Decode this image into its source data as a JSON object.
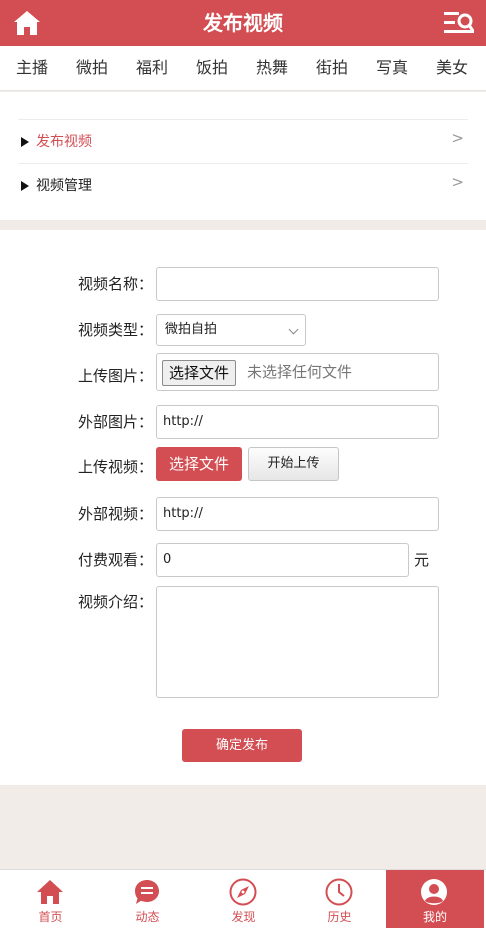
{
  "header": {
    "title": "发布视频",
    "left_icon": "home-icon",
    "right_icon": "search-menu-icon"
  },
  "categories": [
    "主播",
    "微拍",
    "福利",
    "饭拍",
    "热舞",
    "街拍",
    "写真",
    "美女"
  ],
  "sidebar": {
    "items": [
      {
        "label": "发布视频",
        "active": true,
        "chevron": ">"
      },
      {
        "label": "视频管理",
        "active": false,
        "chevron": ">"
      }
    ]
  },
  "form": {
    "name_label": "视频名称：",
    "name_value": "",
    "type_label": "视频类型：",
    "type_value": "微拍自拍",
    "upload_image_label": "上传图片：",
    "choose_file_button": "选择文件",
    "no_file_text": "未选择任何文件",
    "external_image_label": "外部图片：",
    "external_image_value": "http://",
    "upload_video_label": "上传视频：",
    "upload_video_choose": "选择文件",
    "start_upload_button": "开始上传",
    "external_video_label": "外部视频：",
    "external_video_value": "http://",
    "paid_label": "付费观看：",
    "paid_value": "0",
    "paid_unit": "元",
    "intro_label": "视频介绍：",
    "submit_button": "确定发布"
  },
  "tabbar": {
    "items": [
      {
        "label": "首页",
        "icon": "home-icon"
      },
      {
        "label": "动态",
        "icon": "chat-bubble-icon"
      },
      {
        "label": "发现",
        "icon": "compass-icon"
      },
      {
        "label": "历史",
        "icon": "clock-icon"
      },
      {
        "label": "我的",
        "icon": "user-icon",
        "active": true
      }
    ]
  },
  "colors": {
    "accent": "#d34e53",
    "background": "#f1ece8",
    "active_link": "#d34e53"
  }
}
